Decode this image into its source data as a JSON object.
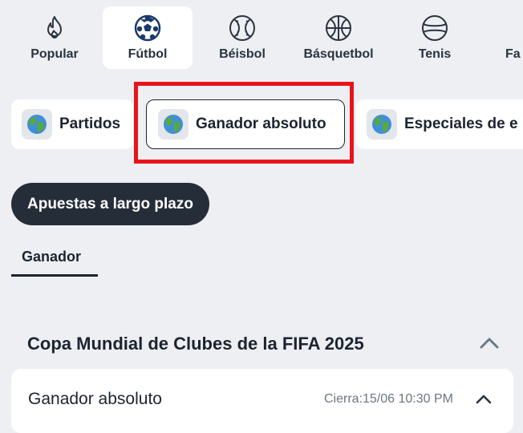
{
  "sports": [
    {
      "id": "popular",
      "label": "Popular",
      "icon": "flame-icon",
      "active": false
    },
    {
      "id": "futbol",
      "label": "Fútbol",
      "icon": "soccer-ball-icon",
      "active": true
    },
    {
      "id": "beisbol",
      "label": "Béisbol",
      "icon": "baseball-icon",
      "active": false
    },
    {
      "id": "basquetbol",
      "label": "Básquetbol",
      "icon": "basketball-icon",
      "active": false
    },
    {
      "id": "tenis",
      "label": "Tenis",
      "icon": "tennis-ball-icon",
      "active": false
    },
    {
      "id": "partial",
      "label": "Fa",
      "icon": "",
      "active": false
    }
  ],
  "market_tabs": [
    {
      "label": "Partidos",
      "icon": "globe-icon",
      "selected": false
    },
    {
      "label": "Ganador absoluto",
      "icon": "globe-icon",
      "selected": true
    },
    {
      "label": "Especiales de e",
      "icon": "globe-icon",
      "selected": false
    }
  ],
  "long_term_button": "Apuestas a largo plazo",
  "subtab": "Ganador",
  "competition": {
    "title": "Copa Mundial de Clubes de la FIFA 2025",
    "market": {
      "name": "Ganador absoluto",
      "closes": "Cierra:15/06 10:30 PM"
    }
  },
  "colors": {
    "background": "#edeff2",
    "highlight": "#e8141b",
    "dark": "#252d38"
  }
}
